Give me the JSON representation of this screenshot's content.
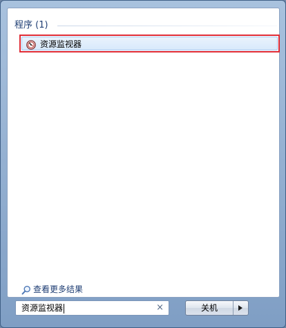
{
  "results": {
    "section_title": "程序 (1)",
    "items": [
      {
        "label": "资源监视器",
        "icon": "resource-monitor-icon"
      }
    ]
  },
  "see_more": {
    "label": "查看更多结果",
    "icon": "search-icon"
  },
  "search": {
    "value": "资源监视器",
    "clear_icon": "×"
  },
  "shutdown": {
    "label": "关机",
    "arrow_icon": "triangle-right-icon"
  },
  "colors": {
    "highlight_border": "#df2b35",
    "header_text": "#1e3d73",
    "item_hover_bg": "#dcebfc"
  }
}
